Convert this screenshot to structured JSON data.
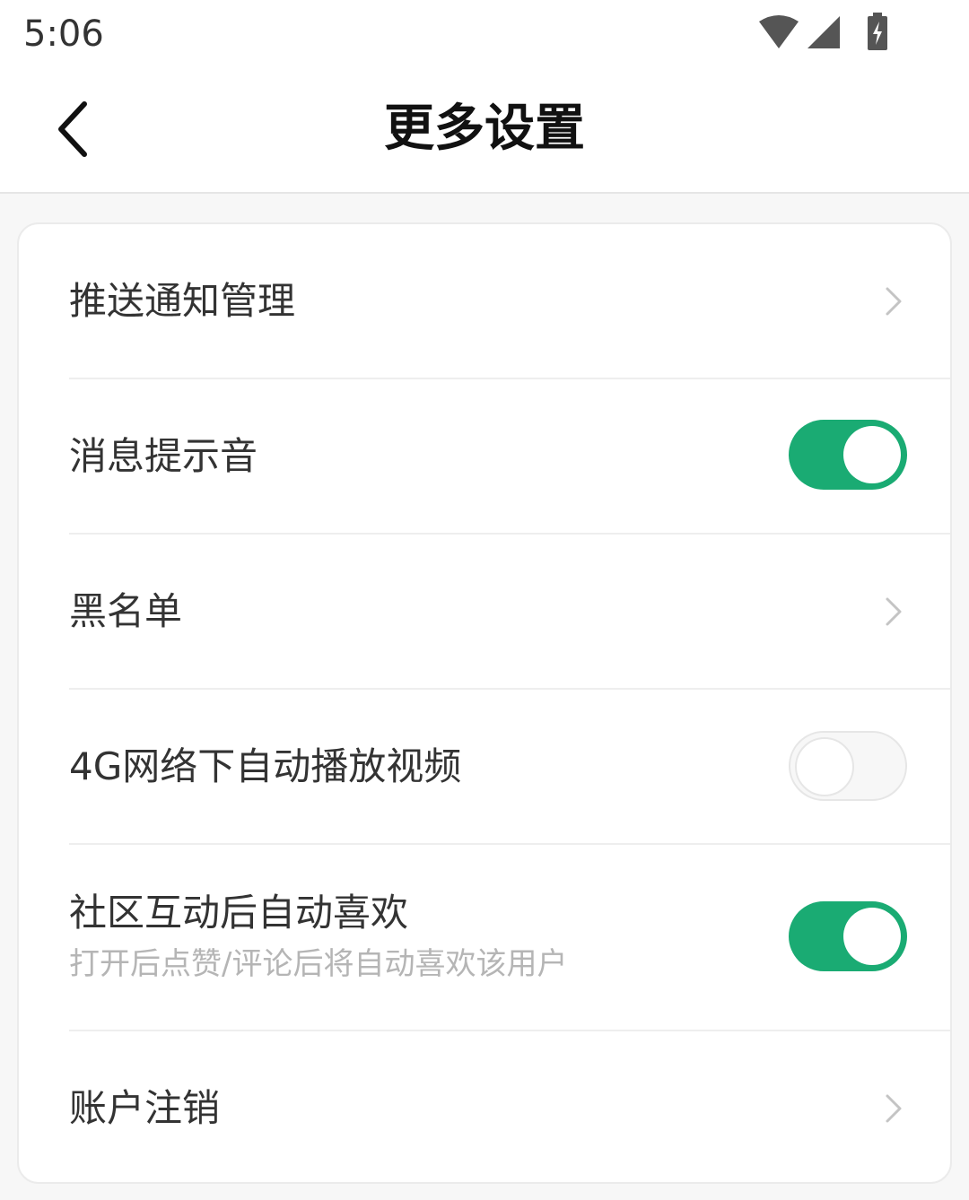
{
  "status_bar": {
    "time": "5:06",
    "icons": [
      "wifi-icon",
      "cell-signal-icon",
      "battery-charging-icon"
    ]
  },
  "header": {
    "title": "更多设置",
    "back_icon": "back-chevron-icon"
  },
  "settings": {
    "push_notifications": {
      "label": "推送通知管理",
      "type": "link"
    },
    "message_sound": {
      "label": "消息提示音",
      "type": "toggle",
      "enabled": true
    },
    "blacklist": {
      "label": "黑名单",
      "type": "link"
    },
    "autoplay_4g": {
      "label": "4G网络下自动播放视频",
      "type": "toggle",
      "enabled": false
    },
    "auto_like": {
      "label": "社区互动后自动喜欢",
      "description": "打开后点赞/评论后将自动喜欢该用户",
      "type": "toggle",
      "enabled": true
    },
    "account_cancel": {
      "label": "账户注销",
      "type": "link"
    }
  },
  "colors": {
    "accent": "#1aab73",
    "toggle_off_track": "#f7f7f7",
    "text_primary": "#333333",
    "text_secondary": "#b5b5b5"
  }
}
